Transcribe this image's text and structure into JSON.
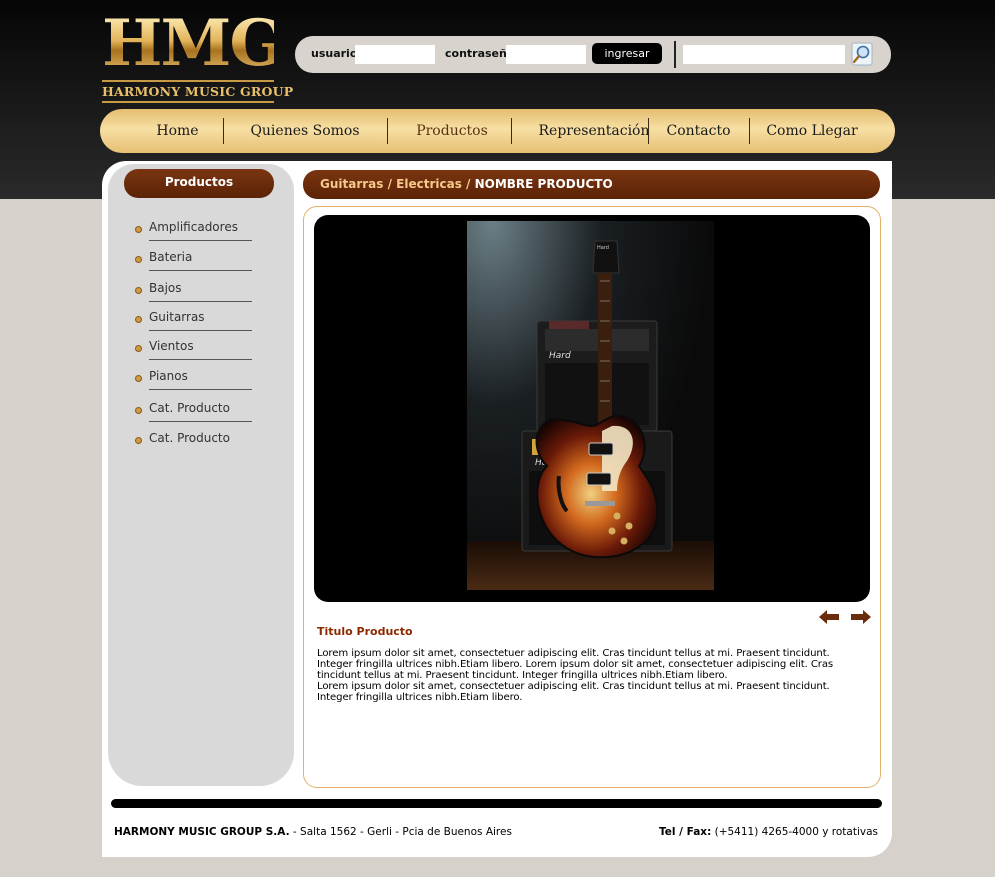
{
  "brand": {
    "logo_mark": "HMG",
    "logo_sub": "HARMONY MUSIC GROUP"
  },
  "login": {
    "user_label": "usuario",
    "password_label": "contraseña",
    "user_value": "",
    "password_value": "",
    "submit_label": "ingresar",
    "search_value": ""
  },
  "nav": {
    "items": [
      {
        "label": "Home"
      },
      {
        "label": "Quienes Somos"
      },
      {
        "label": "Productos"
      },
      {
        "label": "Representación"
      },
      {
        "label": "Contacto"
      },
      {
        "label": "Como Llegar"
      }
    ],
    "active": "Productos"
  },
  "sidebar": {
    "title": "Productos",
    "items": [
      {
        "label": "Amplificadores"
      },
      {
        "label": "Bateria"
      },
      {
        "label": "Bajos"
      },
      {
        "label": "Guitarras"
      },
      {
        "label": "Vientos"
      },
      {
        "label": "Pianos"
      },
      {
        "label": "Cat. Producto"
      },
      {
        "label": "Cat. Producto"
      }
    ]
  },
  "breadcrumb": {
    "path": "Guitarras / Electricas / ",
    "current": "NOMBRE PRODUCTO"
  },
  "product": {
    "title": "Titulo Producto",
    "paragraphs": [
      "Lorem ipsum dolor sit amet, consectetuer adipiscing elit. Cras tincidunt tellus at mi. Praesent tincidunt. Integer fringilla ultrices nibh.Etiam libero. Lorem ipsum dolor sit amet, consectetuer adipiscing elit. Cras tincidunt tellus at mi. Praesent tincidunt. Integer fringilla ultrices nibh.Etiam libero.",
      "Lorem ipsum dolor sit amet, consectetuer adipiscing elit. Cras tincidunt tellus at mi. Praesent tincidunt. Integer fringilla ultrices nibh.Etiam libero."
    ],
    "amp_brand": "Hard"
  },
  "footer": {
    "company": "HARMONY MUSIC GROUP S.A.",
    "address": " - Salta 1562 - Gerli - Pcia de Buenos Aires",
    "phone_label": "Tel / Fax:",
    "phone": " (+5411) 4265-4000 y rotativas"
  },
  "colors": {
    "accent_brown": "#6b2c0b",
    "gold": "#e4bd6f",
    "title_red": "#8b2a00"
  }
}
